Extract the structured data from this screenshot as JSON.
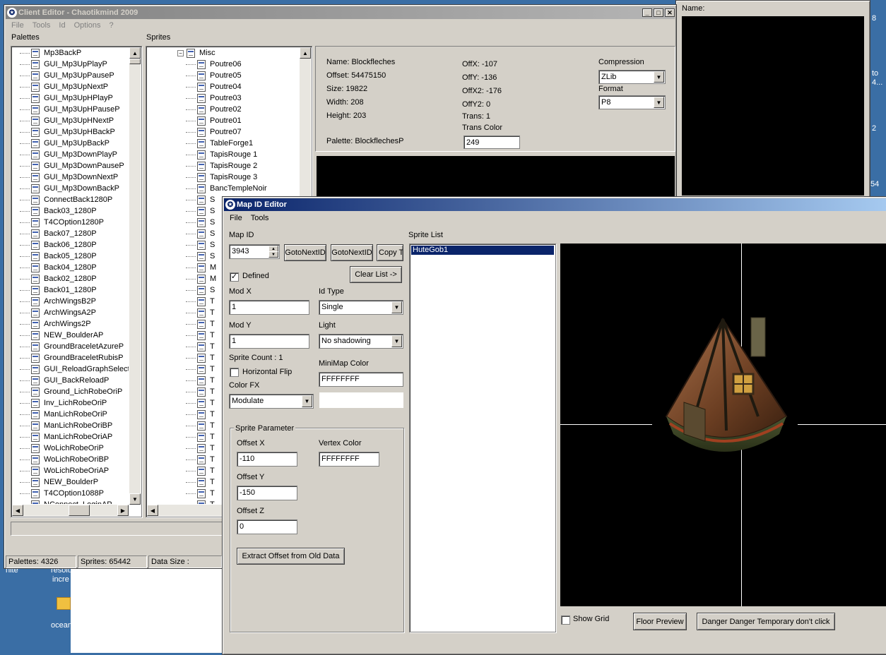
{
  "desktop": {
    "labels": [
      "nite",
      "resolu",
      "incre",
      "ocean"
    ],
    "right_edge": [
      "8",
      "to",
      "4...",
      "2",
      "54"
    ]
  },
  "right_window": {
    "name_label": "Name:"
  },
  "client_editor": {
    "title": "Client Editor - Chaotikmind 2009",
    "menu": [
      "File",
      "Tools",
      "Id",
      "Options",
      "?"
    ],
    "palettes_label": "Palettes",
    "sprites_label": "Sprites",
    "palettes": [
      "Mp3BackP",
      "GUI_Mp3UpPlayP",
      "GUI_Mp3UpPauseP",
      "GUI_Mp3UpNextP",
      "GUI_Mp3UpHPlayP",
      "GUI_Mp3UpHPauseP",
      "GUI_Mp3UpHNextP",
      "GUI_Mp3UpHBackP",
      "GUI_Mp3UpBackP",
      "GUI_Mp3DownPlayP",
      "GUI_Mp3DownPauseP",
      "GUI_Mp3DownNextP",
      "GUI_Mp3DownBackP",
      "ConnectBack1280P",
      "Back03_1280P",
      "T4COption1280P",
      "Back07_1280P",
      "Back06_1280P",
      "Back05_1280P",
      "Back04_1280P",
      "Back02_1280P",
      "Back01_1280P",
      "ArchWingsB2P",
      "ArchWingsA2P",
      "ArchWings2P",
      "NEW_BoulderAP",
      "GroundBraceletAzureP",
      "GroundBraceletRubisP",
      "GUI_ReloadGraphSelectP",
      "GUI_BackReloadP",
      "Ground_LichRobeOriP",
      "Inv_LichRobeOriP",
      "ManLichRobeOriP",
      "ManLichRobeOriBP",
      "ManLichRobeOriAP",
      "WoLichRobeOriP",
      "WoLichRobeOriBP",
      "WoLichRobeOriAP",
      "NEW_BoulderP",
      "T4COption1088P",
      "NConnect_LoginAP"
    ],
    "sprite_root": "Misc",
    "sprites": [
      "Poutre06",
      "Poutre05",
      "Poutre04",
      "Poutre03",
      "Poutre02",
      "Poutre01",
      "Poutre07",
      "TableForge1",
      "TapisRouge 1",
      "TapisRouge 2",
      "TapisRouge 3",
      "BancTempleNoir"
    ],
    "sprite_stubs": [
      "S",
      "S",
      "S",
      "S",
      "S",
      "S",
      "M",
      "M",
      "S",
      "T",
      "T",
      "T",
      "T",
      "T",
      "T",
      "T",
      "T",
      "T",
      "T",
      "T",
      "T",
      "T",
      "T",
      "T",
      "T",
      "T",
      "T",
      "T",
      "T"
    ],
    "info": {
      "name": "Name: Blockfleches",
      "offset": "Offset: 54475150",
      "size": "Size: 19822",
      "width": "Width: 208",
      "height": "Height: 203",
      "palette": "Palette: BlockflechesP",
      "offx": "OffX: -107",
      "offy": "OffY: -136",
      "offx2": "OffX2: -176",
      "offy2": "OffY2: 0",
      "trans": "Trans: 1",
      "trans_color_label": "Trans Color",
      "trans_color": "249",
      "compression_label": "Compression",
      "compression": "ZLib",
      "format_label": "Format",
      "format": "P8"
    },
    "status": {
      "palettes": "Palettes: 4326",
      "sprites": "Sprites: 65442",
      "data_size": "Data Size :"
    }
  },
  "map_id_editor": {
    "title": "Map ID Editor",
    "menu": [
      "File",
      "Tools"
    ],
    "map_id_label": "Map ID",
    "map_id": "3943",
    "goto_next_1": "GotoNextID",
    "goto_next_2": "GotoNextID",
    "copy_to": "Copy To",
    "defined_label": "Defined",
    "defined": true,
    "clear_list": "Clear List ->",
    "mod_x_label": "Mod X",
    "mod_x": "1",
    "mod_y_label": "Mod Y",
    "mod_y": "1",
    "id_type_label": "Id Type",
    "id_type": "Single",
    "light_label": "Light",
    "light": "No shadowing",
    "sprite_count": "Sprite Count : 1",
    "hflip_label": "Horizontal Flip",
    "color_fx_label": "Color FX",
    "color_fx": "Modulate",
    "minimap_color_label": "MiniMap Color",
    "minimap_color": "FFFFFFFF",
    "sprite_param_label": "Sprite Parameter",
    "offset_x_label": "Offset X",
    "offset_x": "-110",
    "offset_y_label": "Offset Y",
    "offset_y": "-150",
    "offset_z_label": "Offset Z",
    "offset_z": "0",
    "vertex_color_label": "Vertex Color",
    "vertex_color": "FFFFFFFF",
    "extract_btn": "Extract Offset from Old Data",
    "sprite_list_label": "Sprite List",
    "sprite_list": [
      "HuteGob1"
    ],
    "show_grid_label": "Show Grid",
    "floor_preview": "Floor Preview",
    "danger_btn": "Danger Danger Temporary don't click"
  }
}
